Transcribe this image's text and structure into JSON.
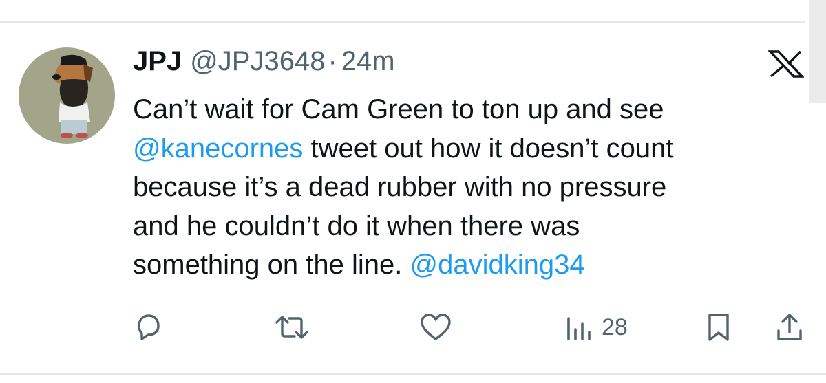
{
  "tweet": {
    "display_name": "JPJ",
    "handle": "@JPJ3648",
    "separator": "·",
    "time": "24m",
    "body": {
      "line1": "Can’t wait for Cam Green to ton up and see",
      "mention1": "@kanecornes",
      "line2_rest": " tweet out how it doesn’t count",
      "line3": "because it’s a dead rubber with no pressure",
      "line4": "and he couldn’t do it when there was",
      "line5": "something on the line. ",
      "mention2": "@davidking34"
    }
  },
  "actions": {
    "reply_icon": "reply-icon",
    "retweet_icon": "retweet-icon",
    "like_icon": "heart-icon",
    "views_icon": "views-icon",
    "views_count": "28",
    "bookmark_icon": "bookmark-icon",
    "share_icon": "share-icon"
  },
  "branding": {
    "logo": "x-logo-icon"
  },
  "colors": {
    "text": "#0f1419",
    "secondary": "#536471",
    "link": "#1d9bf0",
    "avatar_background": "#a2a589"
  }
}
